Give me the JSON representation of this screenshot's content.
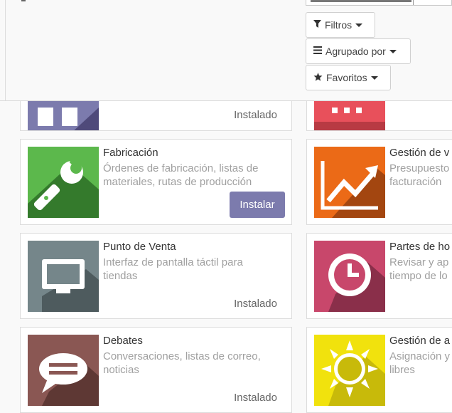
{
  "filters": {
    "filtros_label": "Filtros",
    "agrupado_label": "Agrupado por",
    "favoritos_label": "Favoritos"
  },
  "apps_left": [
    {
      "name": "",
      "description": "",
      "status": "Instalado",
      "icon": "people-icon",
      "color": "#7c7bad"
    },
    {
      "name": "Fabricación",
      "description": "Órdenes de fabricación, listas de materiales, rutas de producción",
      "action": "Instalar",
      "icon": "wrench-icon",
      "color": "#5cb84c"
    },
    {
      "name": "Punto de Venta",
      "description": "Interfaz de pantalla táctil para tiendas",
      "status": "Instalado",
      "icon": "monitor-icon",
      "color": "#75868a"
    },
    {
      "name": "Debates",
      "description": "Conversaciones, listas de correo, noticias",
      "status": "Instalado",
      "icon": "chat-bubble-icon",
      "color": "#8a5753"
    }
  ],
  "apps_right": [
    {
      "name": "",
      "description": "",
      "icon": "building-icon",
      "color": "#e8505b"
    },
    {
      "name": "Gestión de v",
      "description": "Presupuesto facturación",
      "icon": "chart-up-icon",
      "color": "#eb6a17"
    },
    {
      "name": "Partes de ho",
      "description": "Revisar y ap tiempo de lo",
      "icon": "clock-icon",
      "color": "#c8476b"
    },
    {
      "name": "Gestión de a",
      "description": "Asignación y libres",
      "icon": "sun-icon",
      "color": "#f1e20d"
    }
  ]
}
